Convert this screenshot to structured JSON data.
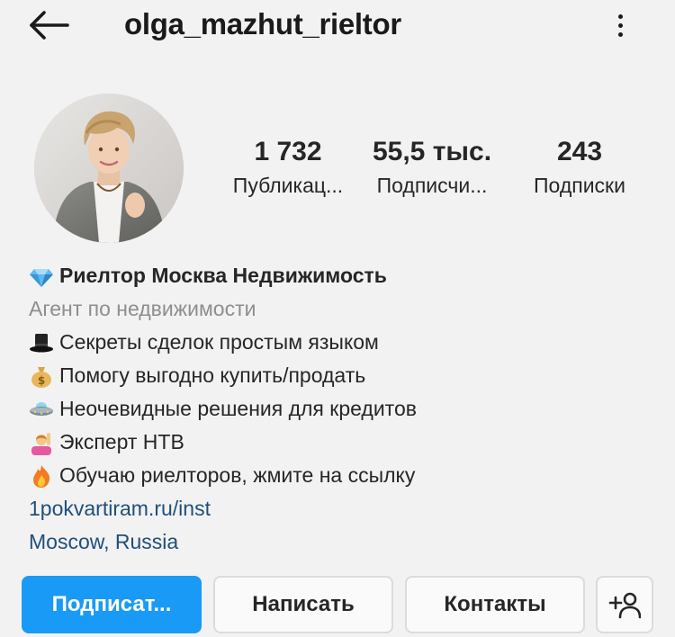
{
  "header": {
    "username": "olga_mazhut_rieltor",
    "back_icon": "arrow-left-icon",
    "more_icon": "more-vertical-icon"
  },
  "stats": [
    {
      "value": "1 732",
      "label": "Публикац..."
    },
    {
      "value": "55,5 тыс.",
      "label": "Подписчи..."
    },
    {
      "value": "243",
      "label": "Подписки"
    }
  ],
  "bio": {
    "name": "Риелтор Москва Недвижимость",
    "name_icon": "diamond-icon",
    "category": "Агент по недвижимости",
    "lines": [
      {
        "icon": "top-hat-icon",
        "text": "Секреты сделок простым языком"
      },
      {
        "icon": "money-bag-icon",
        "text": "Помогу выгодно купить/продать"
      },
      {
        "icon": "flying-saucer-icon",
        "text": "Неочевидные решения для кредитов"
      },
      {
        "icon": "woman-raising-hand-icon",
        "text": "Эксперт НТВ"
      },
      {
        "icon": "fire-icon",
        "text": "Обучаю риелторов, жмите на ссылку"
      }
    ],
    "link": "1pokvartiram.ru/inst",
    "location": "Moscow, Russia"
  },
  "actions": {
    "follow_label": "Подписат...",
    "message_label": "Написать",
    "contacts_label": "Контакты",
    "add_user_icon": "add-user-icon"
  },
  "colors": {
    "background": "#f2f2f2",
    "primary_button": "#1a9af7",
    "link": "#1f4f7a",
    "secondary_text": "#8e8e8e"
  }
}
